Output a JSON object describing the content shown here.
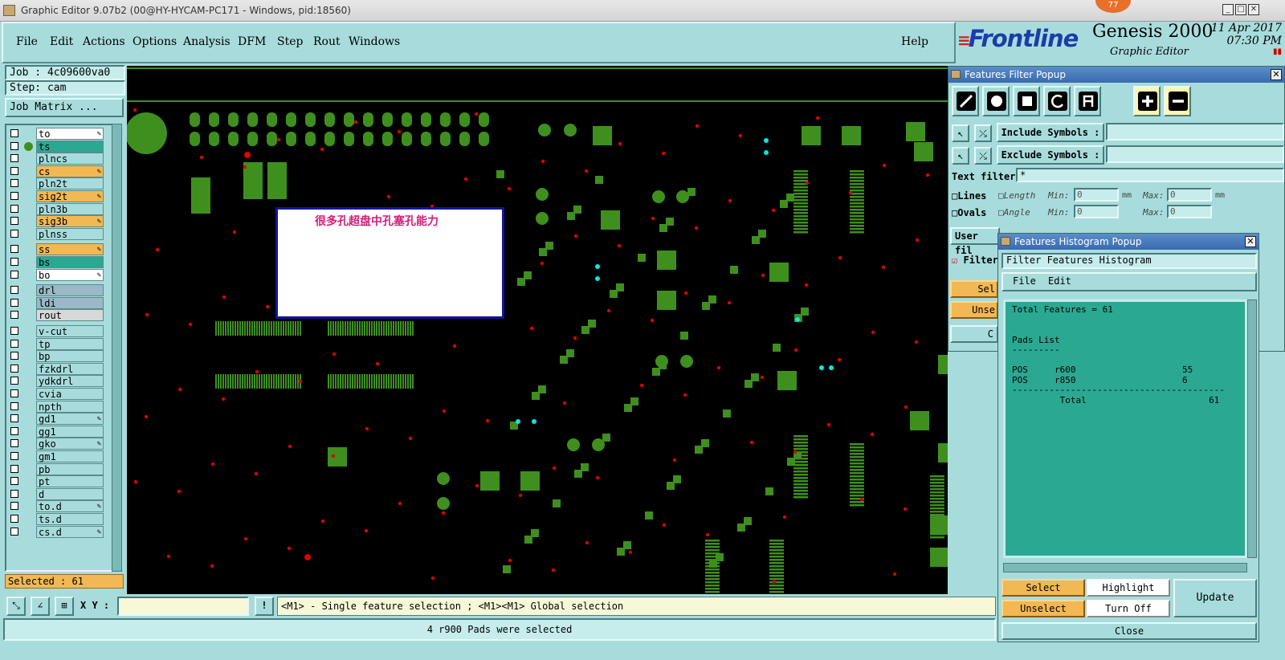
{
  "window": {
    "title": "Graphic Editor 9.07b2 (00@HY-HYCAM-PC171 - Windows, pid:18560)",
    "badge": "77"
  },
  "menu": {
    "items": [
      "File",
      "Edit",
      "Actions",
      "Options",
      "Analysis",
      "DFM",
      "Step",
      "Rout",
      "Windows"
    ],
    "help": "Help"
  },
  "brand": {
    "name": "Frontline",
    "product": "Genesis 2000",
    "subtitle": "Graphic Editor",
    "date": "11 Apr 2017",
    "time": "07:30 PM"
  },
  "left": {
    "job": "Job : 4c09600va0",
    "step": "Step: cam",
    "job_matrix": "Job Matrix ...",
    "selected": "Selected : 61",
    "layers": [
      {
        "name": "to",
        "color": "#ffffff",
        "mark": "✎"
      },
      {
        "name": "ts",
        "color": "#2aa892",
        "mark": ""
      },
      {
        "name": "plncs",
        "color": "#a8dcdc",
        "mark": ""
      },
      {
        "name": "cs",
        "color": "#f2b854",
        "mark": "✎"
      },
      {
        "name": "pln2t",
        "color": "#a8dcdc",
        "mark": ""
      },
      {
        "name": "sig2t",
        "color": "#f2b854",
        "mark": "✎"
      },
      {
        "name": "pln3b",
        "color": "#a8dcdc",
        "mark": ""
      },
      {
        "name": "sig3b",
        "color": "#f2b854",
        "mark": "✎"
      },
      {
        "name": "plnss",
        "color": "#a8dcdc",
        "mark": ""
      },
      {
        "name": "ss",
        "color": "#f2b854",
        "mark": "✎"
      },
      {
        "name": "bs",
        "color": "#2aa892",
        "mark": ""
      },
      {
        "name": "bo",
        "color": "#ffffff",
        "mark": "✎"
      },
      {
        "name": "drl",
        "color": "#9ab8c8",
        "mark": ""
      },
      {
        "name": "ldi",
        "color": "#9ab8c8",
        "mark": ""
      },
      {
        "name": "rout",
        "color": "#d8d8d8",
        "mark": ""
      },
      {
        "name": "v-cut",
        "color": "#a8dcdc",
        "mark": ""
      },
      {
        "name": "tp",
        "color": "#a8dcdc",
        "mark": ""
      },
      {
        "name": "bp",
        "color": "#a8dcdc",
        "mark": ""
      },
      {
        "name": "fzkdrl",
        "color": "#a8dcdc",
        "mark": ""
      },
      {
        "name": "ydkdrl",
        "color": "#a8dcdc",
        "mark": ""
      },
      {
        "name": "cvia",
        "color": "#a8dcdc",
        "mark": ""
      },
      {
        "name": "npth",
        "color": "#a8dcdc",
        "mark": ""
      },
      {
        "name": "gd1",
        "color": "#a8dcdc",
        "mark": "✎"
      },
      {
        "name": "gg1",
        "color": "#a8dcdc",
        "mark": ""
      },
      {
        "name": "gko",
        "color": "#a8dcdc",
        "mark": "✎"
      },
      {
        "name": "gm1",
        "color": "#a8dcdc",
        "mark": ""
      },
      {
        "name": "pb",
        "color": "#a8dcdc",
        "mark": ""
      },
      {
        "name": "pt",
        "color": "#a8dcdc",
        "mark": ""
      },
      {
        "name": "d",
        "color": "#a8dcdc",
        "mark": ""
      },
      {
        "name": "to.d",
        "color": "#a8dcdc",
        "mark": "✎"
      },
      {
        "name": "ts.d",
        "color": "#a8dcdc",
        "mark": ""
      },
      {
        "name": "cs.d",
        "color": "#a8dcdc",
        "mark": "✎"
      }
    ]
  },
  "canvas": {
    "note": "很多孔超盘中孔塞孔能力"
  },
  "bottom": {
    "xy_label": "X Y :",
    "message": "<M1> - Single feature selection ; <M1><M1> Global selection",
    "status": "4 r900 Pads were selected"
  },
  "filter": {
    "title": "Features Filter Popup",
    "include": "Include Symbols :",
    "exclude": "Exclude Symbols :",
    "text_filter": "Text filter",
    "text_value": "*",
    "lines": "Lines",
    "ovals": "Ovals",
    "length": "Length",
    "angle": "Angle",
    "min": "Min:",
    "max": "Max:",
    "mm": "mm",
    "zero": "0",
    "user_filter": "User fil",
    "filter_cb": "Filter",
    "sel": "Sel",
    "unsel": "Unse",
    "c": "C"
  },
  "histogram": {
    "title": "Features Histogram Popup",
    "heading": "Filter Features Histogram",
    "menu": [
      "File",
      "Edit"
    ],
    "total_line": "Total Features = 61",
    "pads_title": "Pads List",
    "underline": "---------",
    "rows": [
      {
        "pol": "POS",
        "sym": "r600",
        "count": "55"
      },
      {
        "pol": "POS",
        "sym": "r850",
        "count": "6"
      }
    ],
    "dashes": "----------------------------------------",
    "total_label": "Total",
    "total": "61",
    "select": "Select",
    "highlight": "Highlight",
    "unselect": "Unselect",
    "turn_off": "Turn Off",
    "update": "Update",
    "close": "Close"
  },
  "colors": {
    "panel": "#a8dcdc",
    "pad_green": "#3f8f1f",
    "drill_red": "#dd0000",
    "cyan": "#00e8e8"
  }
}
